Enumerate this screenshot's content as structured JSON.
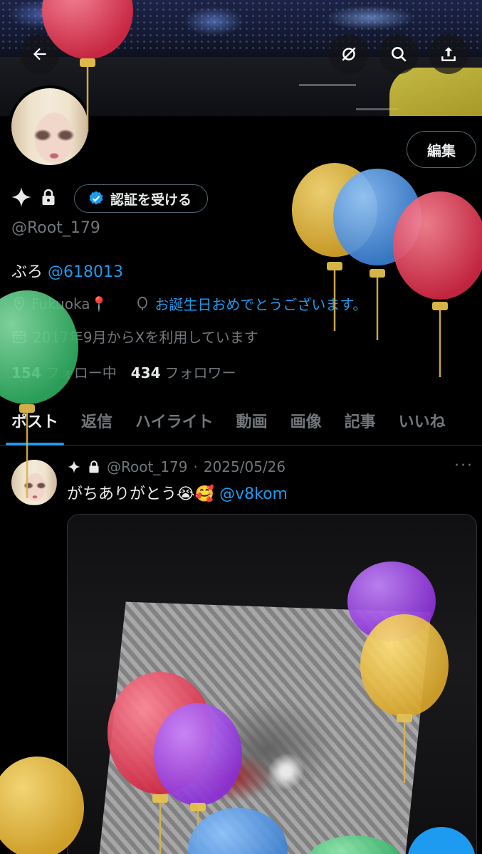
{
  "header": {
    "back_label": "back",
    "icons": [
      "back-icon",
      "crossed-circle-icon",
      "search-icon",
      "share-icon"
    ]
  },
  "profile": {
    "edit_label": "編集",
    "verify_label": "認証を受ける",
    "handle": "@Root_179",
    "bio_text": "ぶろ",
    "bio_mention": "@618013",
    "location": "Fukuoka📍",
    "website": "お誕生日おめでとうございます。",
    "joined": "2017年9月からXを利用しています",
    "following_count": "154",
    "following_label": "フォロー中",
    "followers_count": "434",
    "followers_label": "フォロワー"
  },
  "tabs": [
    "ポスト",
    "返信",
    "ハイライト",
    "動画",
    "画像",
    "記事",
    "いいね"
  ],
  "post": {
    "handle": "@Root_179",
    "separator": "·",
    "date": "2025/05/26",
    "more": "···",
    "text": "がちありがとう😭🥰",
    "mention": "@v8kom"
  },
  "colors": {
    "accent": "#1d9bf0",
    "muted": "#71767b",
    "text": "#e7e9ea",
    "border": "#536471"
  },
  "balloons": {
    "colors": [
      "#e13b55",
      "#e8b93a",
      "#4a90e2",
      "#41c478",
      "#9b3de0"
    ]
  }
}
